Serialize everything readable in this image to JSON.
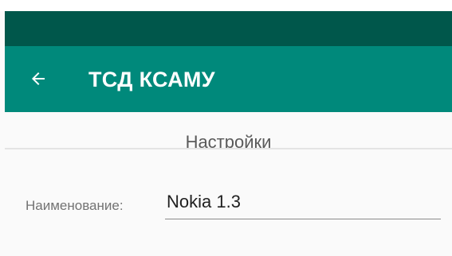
{
  "app_bar": {
    "title": "ТСД КСАМУ",
    "back_icon": "arrow-left-icon"
  },
  "page": {
    "title": "Настройки"
  },
  "form": {
    "name_label": "Наименование:",
    "name_value": "Nokia 1.3"
  },
  "colors": {
    "status_bar": "#00574b",
    "app_bar": "#00897b",
    "background": "#fafafa"
  }
}
